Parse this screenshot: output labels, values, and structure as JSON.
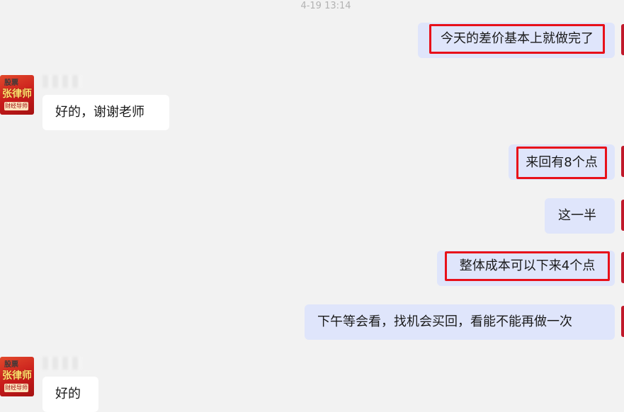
{
  "chat": {
    "timestamp": "4-19 13:14",
    "contact": {
      "avatar_text_top": "股票",
      "avatar_text_main": "张律师",
      "avatar_text_bottom": "财经导师"
    },
    "messages": [
      {
        "side": "right",
        "text": "今天的差价基本上就做完了",
        "highlighted": true
      },
      {
        "side": "left",
        "text": "好的，谢谢老师",
        "highlighted": false
      },
      {
        "side": "right",
        "text": "来回有8个点",
        "highlighted": true
      },
      {
        "side": "right",
        "text": "这一半",
        "highlighted": false
      },
      {
        "side": "right",
        "text": "整体成本可以下来4个点",
        "highlighted": true
      },
      {
        "side": "right",
        "text": "下午等会看，找机会买回，看能不能再做一次",
        "highlighted": false
      },
      {
        "side": "left",
        "text": "好的",
        "highlighted": false
      }
    ]
  },
  "colors": {
    "background": "#f2f2f2",
    "outgoing_bubble": "#dfe5fb",
    "incoming_bubble": "#ffffff",
    "highlight_border": "#e8101a",
    "timestamp": "#b2b2b2"
  }
}
